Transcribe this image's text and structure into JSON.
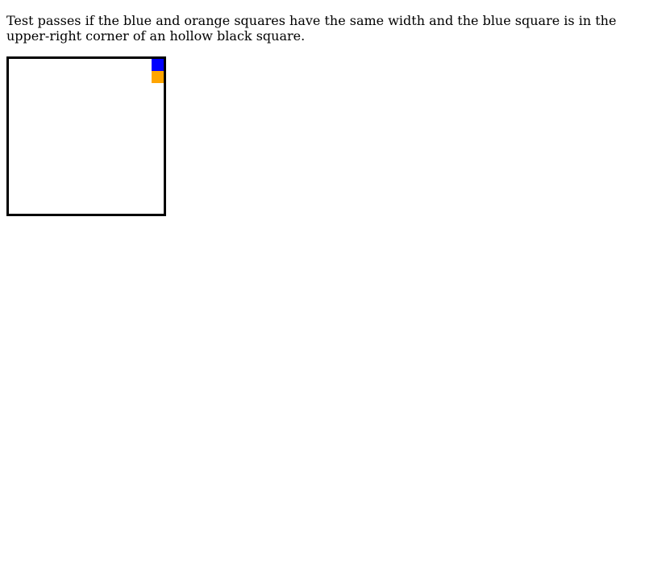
{
  "instruction": {
    "text": "Test passes if the blue and orange squares have the same width and the blue square is in the upper-right corner of an hollow black square."
  },
  "colors": {
    "blue": "#0000ff",
    "orange": "#ffa500",
    "border": "#000000"
  }
}
